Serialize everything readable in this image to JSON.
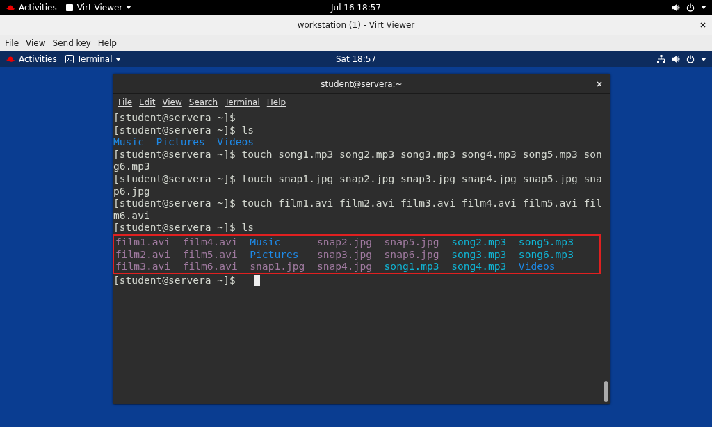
{
  "host_top_bar": {
    "activities": "Activities",
    "app_menu": "Virt Viewer",
    "clock": "Jul 16  18:57"
  },
  "viewer_window": {
    "title": "workstation (1) - Virt Viewer",
    "menu": [
      "File",
      "View",
      "Send key",
      "Help"
    ]
  },
  "guest_top_bar": {
    "activities": "Activities",
    "app_menu": "Terminal",
    "clock": "Sat 18:57"
  },
  "terminal": {
    "title": "student@servera:~",
    "menu": [
      "File",
      "Edit",
      "View",
      "Search",
      "Terminal",
      "Help"
    ],
    "lines_before": [
      [
        {
          "text": "[student@servera ~]$",
          "color": "#d3d7cf"
        }
      ],
      [
        {
          "text": "[student@servera ~]$ ls",
          "color": "#d3d7cf"
        }
      ],
      [
        {
          "text": "Music",
          "color": "#1e88e5"
        },
        {
          "text": "Pictures",
          "color": "#1e88e5"
        },
        {
          "text": "Videos",
          "color": "#1e88e5"
        }
      ],
      [
        {
          "text": "[student@servera ~]$ touch song1.mp3 song2.mp3 song3.mp3 song4.mp3 song5.mp3 son",
          "color": "#d3d7cf"
        }
      ],
      [
        {
          "text": "g6.mp3",
          "color": "#d3d7cf"
        }
      ],
      [
        {
          "text": "[student@servera ~]$ touch snap1.jpg snap2.jpg snap3.jpg snap4.jpg snap5.jpg sna",
          "color": "#d3d7cf"
        }
      ],
      [
        {
          "text": "p6.jpg",
          "color": "#d3d7cf"
        }
      ],
      [
        {
          "text": "[student@servera ~]$ touch film1.avi film2.avi film3.avi film4.avi film5.avi fil",
          "color": "#d3d7cf"
        }
      ],
      [
        {
          "text": "m6.avi",
          "color": "#d3d7cf"
        }
      ],
      [
        {
          "text": "[student@servera ~]$ ls",
          "color": "#d3d7cf"
        }
      ]
    ],
    "ls_output": [
      [
        {
          "text": "film1.avi",
          "color": "#a07aa0"
        },
        {
          "text": "film4.avi",
          "color": "#a07aa0"
        },
        {
          "text": "Music",
          "color": "#1e88e5"
        },
        {
          "text": "snap2.jpg",
          "color": "#a07aa0"
        },
        {
          "text": "snap5.jpg",
          "color": "#a07aa0"
        },
        {
          "text": "song2.mp3",
          "color": "#10b4d4"
        },
        {
          "text": "song5.mp3",
          "color": "#10b4d4"
        }
      ],
      [
        {
          "text": "film2.avi",
          "color": "#a07aa0"
        },
        {
          "text": "film5.avi",
          "color": "#a07aa0"
        },
        {
          "text": "Pictures",
          "color": "#1e88e5"
        },
        {
          "text": "snap3.jpg",
          "color": "#a07aa0"
        },
        {
          "text": "snap6.jpg",
          "color": "#a07aa0"
        },
        {
          "text": "song3.mp3",
          "color": "#10b4d4"
        },
        {
          "text": "song6.mp3",
          "color": "#10b4d4"
        }
      ],
      [
        {
          "text": "film3.avi",
          "color": "#a07aa0"
        },
        {
          "text": "film6.avi",
          "color": "#a07aa0"
        },
        {
          "text": "snap1.jpg",
          "color": "#a07aa0"
        },
        {
          "text": "snap4.jpg",
          "color": "#a07aa0"
        },
        {
          "text": "song1.mp3",
          "color": "#10b4d4"
        },
        {
          "text": "song4.mp3",
          "color": "#10b4d4"
        },
        {
          "text": "Videos",
          "color": "#1e88e5"
        }
      ]
    ],
    "prompt": "[student@servera ~]$"
  }
}
